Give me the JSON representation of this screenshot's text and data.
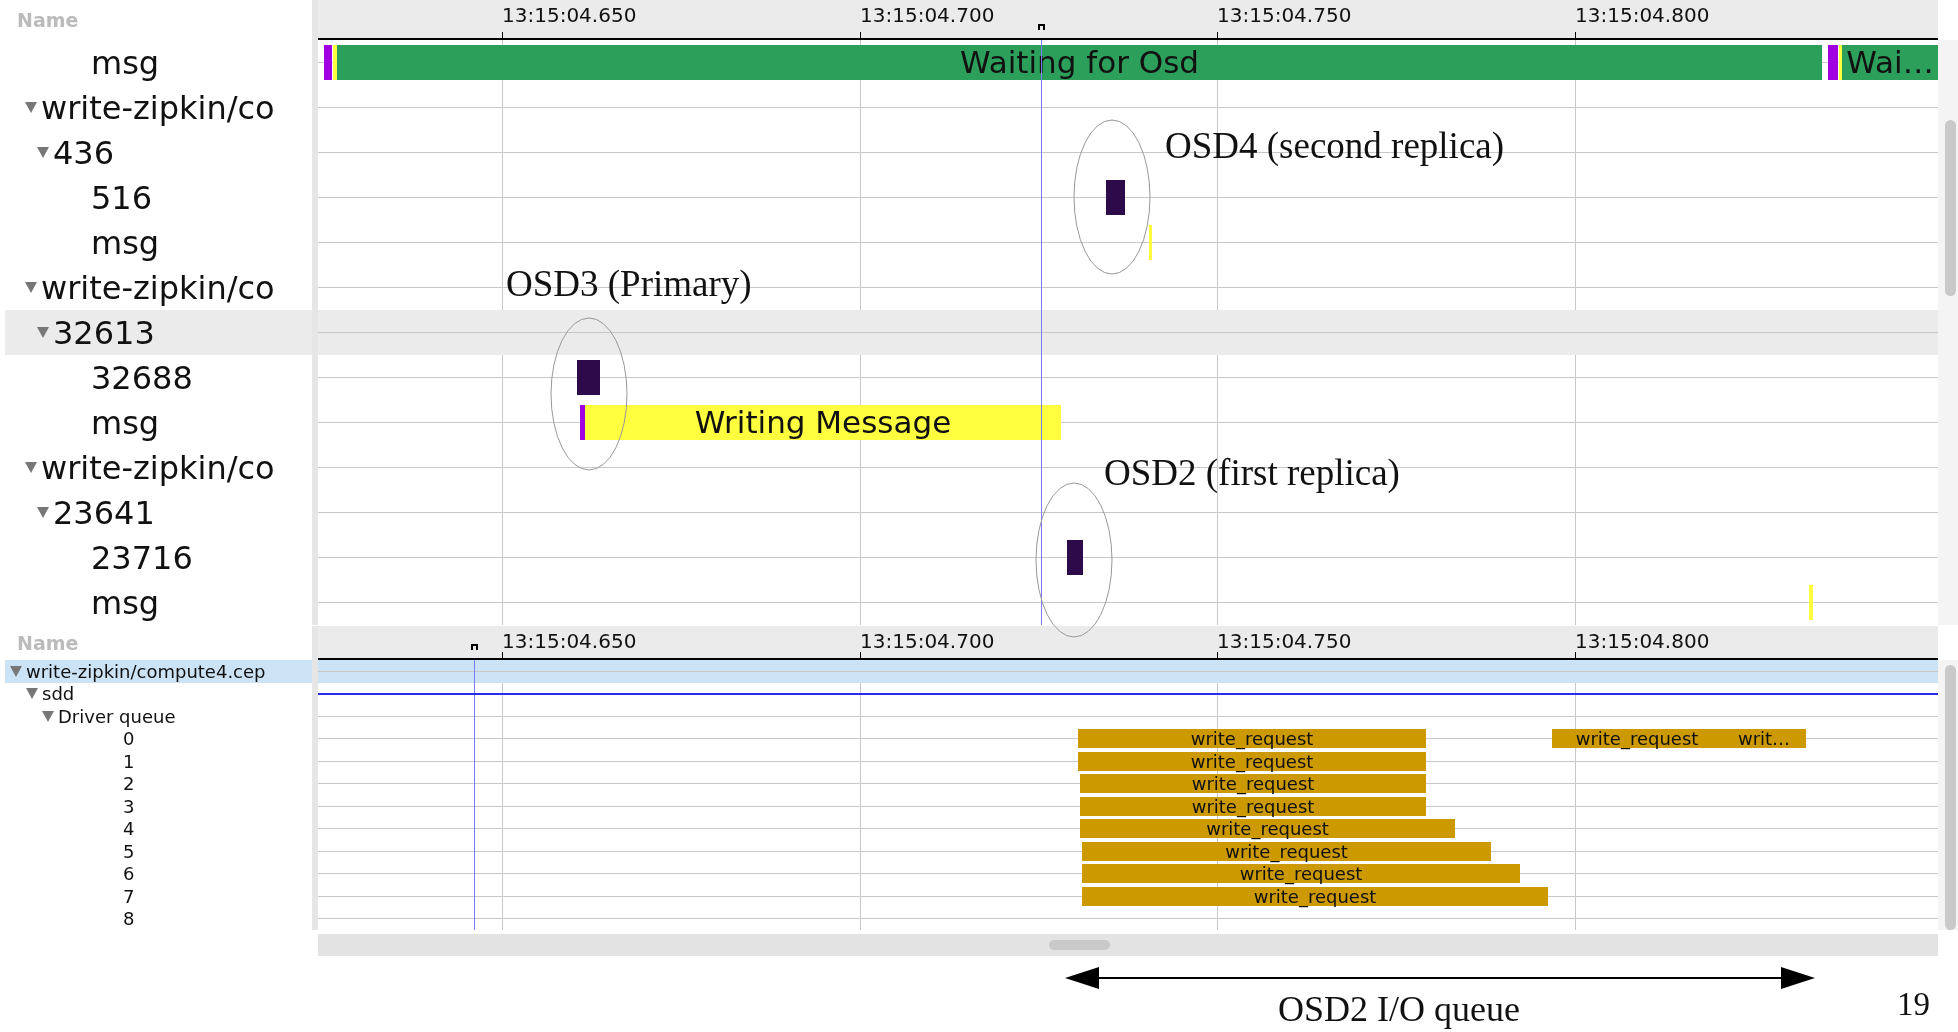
{
  "top_pane": {
    "header": "Name",
    "ticks": [
      "13:15:04.650",
      "13:15:04.700",
      "13:15:04.750",
      "13:15:04.800"
    ],
    "leading_rows": [
      {
        "label": "msg",
        "selected": false,
        "events": [
          {
            "color": "#a000e0"
          },
          {
            "color": "#ffff40"
          },
          {
            "color": "#2ca05a",
            "label": "Waiting for Osd"
          },
          {
            "color": "#a000e0"
          },
          {
            "color": "#ffff40"
          },
          {
            "color": "#2ca05a",
            "label": "Wai…"
          }
        ]
      }
    ],
    "tree": [
      {
        "label": "write-zipkin/co",
        "expanded": true,
        "selected": false,
        "children": [
          {
            "label": "436",
            "expanded": true,
            "selected": false,
            "children": [
              {
                "label": "516",
                "selected": false,
                "events": [
                  {
                    "color": "#2d0a4a"
                  }
                ]
              },
              {
                "label": "msg",
                "selected": false,
                "events": [
                  {
                    "color": "#ffff40"
                  }
                ]
              }
            ]
          }
        ]
      },
      {
        "label": "write-zipkin/co",
        "expanded": true,
        "selected": false,
        "children": [
          {
            "label": "32613",
            "expanded": true,
            "selected": true,
            "children": [
              {
                "label": "32688",
                "selected": false,
                "events": [
                  {
                    "color": "#2d0a4a"
                  }
                ]
              },
              {
                "label": "msg",
                "selected": false,
                "events": [
                  {
                    "color": "#a000e0"
                  },
                  {
                    "color": "#ffff40",
                    "label": "Writing Message"
                  }
                ]
              }
            ]
          }
        ]
      },
      {
        "label": "write-zipkin/co",
        "expanded": true,
        "selected": false,
        "children": [
          {
            "label": "23641",
            "expanded": true,
            "selected": false,
            "children": [
              {
                "label": "23716",
                "selected": false,
                "events": [
                  {
                    "color": "#2d0a4a"
                  }
                ]
              },
              {
                "label": "msg",
                "selected": false,
                "events": [
                  {
                    "color": "#ffff40"
                  }
                ]
              }
            ]
          }
        ]
      }
    ]
  },
  "bottom_pane": {
    "header": "Name",
    "ticks": [
      "13:15:04.650",
      "13:15:04.700",
      "13:15:04.750",
      "13:15:04.800"
    ],
    "tree": [
      {
        "label": "write-zipkin/compute4.cep",
        "expanded": true,
        "selected": true,
        "children": [
          {
            "label": "sdd",
            "expanded": true,
            "selected": false,
            "children": [
              {
                "label": "Driver queue",
                "expanded": true,
                "selected": false,
                "children": [
                  {
                    "label": "0",
                    "selected": false,
                    "events": [
                      {
                        "color": "#cc9900",
                        "label": "write_request"
                      },
                      {
                        "color": "#cc9900",
                        "label": "write_request"
                      },
                      {
                        "color": "#cc9900",
                        "label": "writ…"
                      }
                    ]
                  },
                  {
                    "label": "1",
                    "selected": false,
                    "events": [
                      {
                        "color": "#cc9900",
                        "label": "write_request"
                      }
                    ]
                  },
                  {
                    "label": "2",
                    "selected": false,
                    "events": [
                      {
                        "color": "#cc9900",
                        "label": "write_request"
                      }
                    ]
                  },
                  {
                    "label": "3",
                    "selected": false,
                    "events": [
                      {
                        "color": "#cc9900",
                        "label": "write_request"
                      }
                    ]
                  },
                  {
                    "label": "4",
                    "selected": false,
                    "events": [
                      {
                        "color": "#cc9900",
                        "label": "write_request"
                      }
                    ]
                  },
                  {
                    "label": "5",
                    "selected": false,
                    "events": [
                      {
                        "color": "#cc9900",
                        "label": "write_request"
                      }
                    ]
                  },
                  {
                    "label": "6",
                    "selected": false,
                    "events": [
                      {
                        "color": "#cc9900",
                        "label": "write_request"
                      }
                    ]
                  },
                  {
                    "label": "7",
                    "selected": false,
                    "events": [
                      {
                        "color": "#cc9900",
                        "label": "write_request"
                      }
                    ]
                  },
                  {
                    "label": "8",
                    "selected": false
                  }
                ]
              }
            ]
          }
        ]
      }
    ]
  },
  "annotations": [
    {
      "text": "OSD4 (second replica)"
    },
    {
      "text": "OSD3 (Primary)"
    },
    {
      "text": "OSD2 (first replica)"
    }
  ],
  "footer": {
    "arrow_label": "OSD2 I/O queue",
    "page_number": "19"
  }
}
